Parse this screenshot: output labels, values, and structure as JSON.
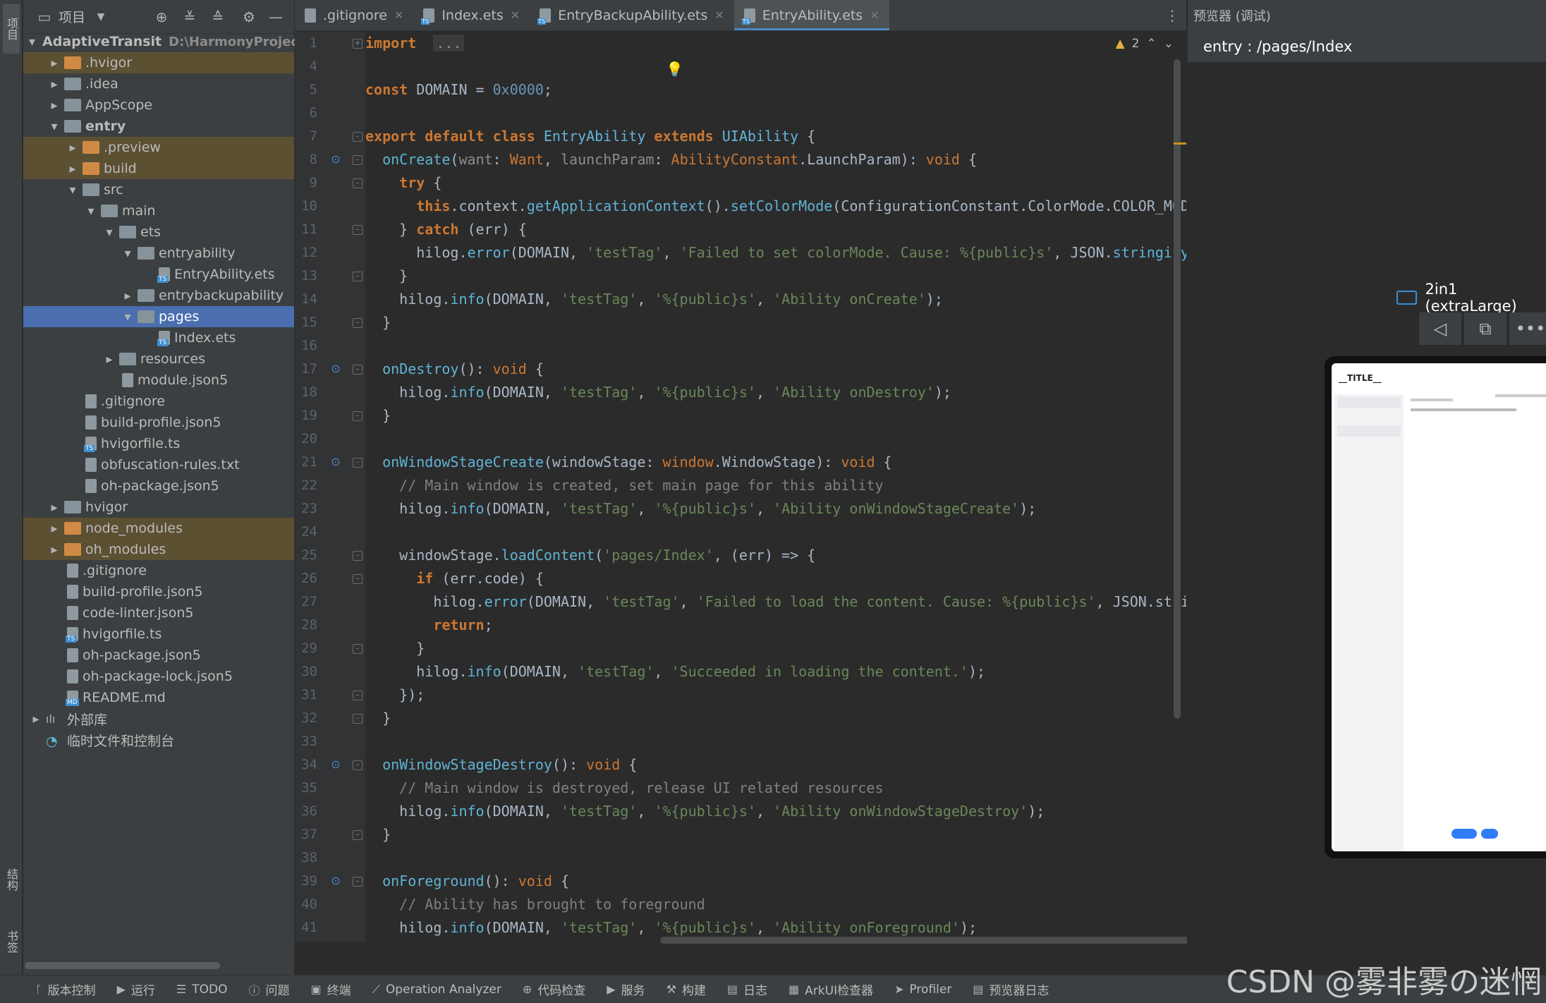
{
  "left_strip": {
    "project": "项目",
    "structure": "结构",
    "bookmarks": "书签"
  },
  "project_panel": {
    "title": "项目",
    "tree": [
      {
        "label": "AdaptiveTransit",
        "path": "D:\\HarmonyProject",
        "depth": 0,
        "arrow": "down",
        "icon": "folder-module",
        "bold": true
      },
      {
        "label": ".hvigor",
        "depth": 1,
        "arrow": "right",
        "icon": "folder-orange",
        "excluded": true
      },
      {
        "label": ".idea",
        "depth": 1,
        "arrow": "right",
        "icon": "folder"
      },
      {
        "label": "AppScope",
        "depth": 1,
        "arrow": "right",
        "icon": "folder"
      },
      {
        "label": "entry",
        "depth": 1,
        "arrow": "down",
        "icon": "folder-module",
        "bold": true
      },
      {
        "label": ".preview",
        "depth": 2,
        "arrow": "right",
        "icon": "folder-orange",
        "excluded": true
      },
      {
        "label": "build",
        "depth": 2,
        "arrow": "right",
        "icon": "folder-orange",
        "excluded": true
      },
      {
        "label": "src",
        "depth": 2,
        "arrow": "down",
        "icon": "folder"
      },
      {
        "label": "main",
        "depth": 3,
        "arrow": "down",
        "icon": "folder"
      },
      {
        "label": "ets",
        "depth": 4,
        "arrow": "down",
        "icon": "folder-blue"
      },
      {
        "label": "entryability",
        "depth": 5,
        "arrow": "down",
        "icon": "folder"
      },
      {
        "label": "EntryAbility.ets",
        "depth": 6,
        "arrow": "",
        "icon": "file-ts"
      },
      {
        "label": "entrybackupability",
        "depth": 5,
        "arrow": "right",
        "icon": "folder"
      },
      {
        "label": "pages",
        "depth": 5,
        "arrow": "down",
        "icon": "folder",
        "selected": true
      },
      {
        "label": "Index.ets",
        "depth": 6,
        "arrow": "",
        "icon": "file-ts"
      },
      {
        "label": "resources",
        "depth": 4,
        "arrow": "right",
        "icon": "folder"
      },
      {
        "label": "module.json5",
        "depth": 4,
        "arrow": "",
        "icon": "file-gen"
      },
      {
        "label": ".gitignore",
        "depth": 2,
        "arrow": "",
        "icon": "file-gen"
      },
      {
        "label": "build-profile.json5",
        "depth": 2,
        "arrow": "",
        "icon": "file-gen"
      },
      {
        "label": "hvigorfile.ts",
        "depth": 2,
        "arrow": "",
        "icon": "file-ts"
      },
      {
        "label": "obfuscation-rules.txt",
        "depth": 2,
        "arrow": "",
        "icon": "file-gen"
      },
      {
        "label": "oh-package.json5",
        "depth": 2,
        "arrow": "",
        "icon": "file-gen"
      },
      {
        "label": "hvigor",
        "depth": 1,
        "arrow": "right",
        "icon": "folder"
      },
      {
        "label": "node_modules",
        "depth": 1,
        "arrow": "right",
        "icon": "folder-orange",
        "excluded": true
      },
      {
        "label": "oh_modules",
        "depth": 1,
        "arrow": "right",
        "icon": "folder-orange",
        "excluded": true
      },
      {
        "label": ".gitignore",
        "depth": 1,
        "arrow": "",
        "icon": "file-gen"
      },
      {
        "label": "build-profile.json5",
        "depth": 1,
        "arrow": "",
        "icon": "file-gen"
      },
      {
        "label": "code-linter.json5",
        "depth": 1,
        "arrow": "",
        "icon": "file-gen"
      },
      {
        "label": "hvigorfile.ts",
        "depth": 1,
        "arrow": "",
        "icon": "file-ts"
      },
      {
        "label": "oh-package.json5",
        "depth": 1,
        "arrow": "",
        "icon": "file-gen"
      },
      {
        "label": "oh-package-lock.json5",
        "depth": 1,
        "arrow": "",
        "icon": "file-gen"
      },
      {
        "label": "README.md",
        "depth": 1,
        "arrow": "",
        "icon": "file-md"
      },
      {
        "label": "外部库",
        "depth": 0,
        "arrow": "right",
        "icon": "library"
      },
      {
        "label": "临时文件和控制台",
        "depth": 0,
        "arrow": "",
        "icon": "scratch"
      }
    ]
  },
  "editor": {
    "tabs": [
      {
        "label": ".gitignore",
        "icon": "file",
        "active": false
      },
      {
        "label": "Index.ets",
        "icon": "ts",
        "active": false
      },
      {
        "label": "EntryBackupAbility.ets",
        "icon": "ts",
        "active": false
      },
      {
        "label": "EntryAbility.ets",
        "icon": "ts",
        "active": true
      }
    ],
    "warnings": "2",
    "lines": [
      {
        "n": "1",
        "fold": "+",
        "code": [
          [
            "kw",
            "import"
          ],
          [
            "",
            "  "
          ],
          [
            "fi",
            "..."
          ]
        ]
      },
      {
        "n": "4",
        "code": []
      },
      {
        "n": "5",
        "code": [
          [
            "kw",
            "const"
          ],
          [
            "",
            " DOMAIN = "
          ],
          [
            "num",
            "0x0000"
          ],
          [
            "",
            ";"
          ]
        ]
      },
      {
        "n": "6",
        "code": []
      },
      {
        "n": "7",
        "fold": "-",
        "code": [
          [
            "kw",
            "export default class"
          ],
          [
            "",
            " "
          ],
          [
            "cls",
            "EntryAbility"
          ],
          [
            "",
            " "
          ],
          [
            "kw",
            "extends"
          ],
          [
            "",
            " "
          ],
          [
            "cls",
            "UIAbility"
          ],
          [
            "",
            " {"
          ]
        ]
      },
      {
        "n": "8",
        "mark": true,
        "fold": "-",
        "code": [
          [
            "",
            "  "
          ],
          [
            "fn",
            "onCreate"
          ],
          [
            "",
            "("
          ],
          [
            "pdim",
            "want"
          ],
          [
            "",
            ": "
          ],
          [
            "ty",
            "Want"
          ],
          [
            "",
            ", "
          ],
          [
            "pdim",
            "launchParam"
          ],
          [
            "",
            ": "
          ],
          [
            "ty",
            "AbilityConstant"
          ],
          [
            "",
            ".LaunchParam): "
          ],
          [
            "kwn",
            "void"
          ],
          [
            "",
            " {"
          ]
        ]
      },
      {
        "n": "9",
        "fold": "-",
        "code": [
          [
            "",
            "    "
          ],
          [
            "kw",
            "try"
          ],
          [
            "",
            " {"
          ]
        ]
      },
      {
        "n": "10",
        "code": [
          [
            "",
            "      "
          ],
          [
            "kw",
            "this"
          ],
          [
            "",
            ".context."
          ],
          [
            "fn",
            "getApplicationContext"
          ],
          [
            "",
            "()."
          ],
          [
            "fn",
            "setColorMode"
          ],
          [
            "",
            "(ConfigurationConstant.ColorMode.COLOR_MOD"
          ]
        ]
      },
      {
        "n": "11",
        "fold": "-",
        "code": [
          [
            "",
            "    } "
          ],
          [
            "kw",
            "catch"
          ],
          [
            "",
            " (err) {"
          ]
        ]
      },
      {
        "n": "12",
        "code": [
          [
            "",
            "      hilog."
          ],
          [
            "fn",
            "error"
          ],
          [
            "",
            "(DOMAIN, "
          ],
          [
            "str",
            "'testTag'"
          ],
          [
            "",
            ", "
          ],
          [
            "str",
            "'Failed to set colorMode. Cause: %{public}s'"
          ],
          [
            "",
            ", JSON."
          ],
          [
            "fn",
            "stringify"
          ]
        ]
      },
      {
        "n": "13",
        "fold": "-",
        "code": [
          [
            "",
            "    }"
          ]
        ]
      },
      {
        "n": "14",
        "code": [
          [
            "",
            "    hilog."
          ],
          [
            "fn",
            "info"
          ],
          [
            "",
            "(DOMAIN, "
          ],
          [
            "str",
            "'testTag'"
          ],
          [
            "",
            ", "
          ],
          [
            "str",
            "'%{public}s'"
          ],
          [
            "",
            ", "
          ],
          [
            "str",
            "'Ability onCreate'"
          ],
          [
            "",
            ");"
          ]
        ]
      },
      {
        "n": "15",
        "fold": "-",
        "code": [
          [
            "",
            "  }"
          ]
        ]
      },
      {
        "n": "16",
        "code": []
      },
      {
        "n": "17",
        "mark": true,
        "fold": "-",
        "code": [
          [
            "",
            "  "
          ],
          [
            "fn",
            "onDestroy"
          ],
          [
            "",
            "(): "
          ],
          [
            "kwn",
            "void"
          ],
          [
            "",
            " {"
          ]
        ]
      },
      {
        "n": "18",
        "code": [
          [
            "",
            "    hilog."
          ],
          [
            "fn",
            "info"
          ],
          [
            "",
            "(DOMAIN, "
          ],
          [
            "str",
            "'testTag'"
          ],
          [
            "",
            ", "
          ],
          [
            "str",
            "'%{public}s'"
          ],
          [
            "",
            ", "
          ],
          [
            "str",
            "'Ability onDestroy'"
          ],
          [
            "",
            ");"
          ]
        ]
      },
      {
        "n": "19",
        "fold": "-",
        "code": [
          [
            "",
            "  }"
          ]
        ]
      },
      {
        "n": "20",
        "code": []
      },
      {
        "n": "21",
        "mark": true,
        "fold": "-",
        "code": [
          [
            "",
            "  "
          ],
          [
            "fn",
            "onWindowStageCreate"
          ],
          [
            "",
            "(windowStage: "
          ],
          [
            "ty",
            "window"
          ],
          [
            "",
            ".WindowStage): "
          ],
          [
            "kwn",
            "void"
          ],
          [
            "",
            " {"
          ]
        ]
      },
      {
        "n": "22",
        "code": [
          [
            "cmt",
            "    // Main window is created, set main page for this ability"
          ]
        ]
      },
      {
        "n": "23",
        "code": [
          [
            "",
            "    hilog."
          ],
          [
            "fn",
            "info"
          ],
          [
            "",
            "(DOMAIN, "
          ],
          [
            "str",
            "'testTag'"
          ],
          [
            "",
            ", "
          ],
          [
            "str",
            "'%{public}s'"
          ],
          [
            "",
            ", "
          ],
          [
            "str",
            "'Ability onWindowStageCreate'"
          ],
          [
            "",
            ");"
          ]
        ]
      },
      {
        "n": "24",
        "code": []
      },
      {
        "n": "25",
        "fold": "-",
        "code": [
          [
            "",
            "    windowStage."
          ],
          [
            "fn",
            "loadContent"
          ],
          [
            "",
            "("
          ],
          [
            "str",
            "'pages/Index'"
          ],
          [
            "",
            ", (err) => {"
          ]
        ]
      },
      {
        "n": "26",
        "fold": "-",
        "code": [
          [
            "",
            "      "
          ],
          [
            "kw",
            "if"
          ],
          [
            "",
            " (err.code) {"
          ]
        ]
      },
      {
        "n": "27",
        "code": [
          [
            "",
            "        hilog."
          ],
          [
            "fn",
            "error"
          ],
          [
            "",
            "(DOMAIN, "
          ],
          [
            "str",
            "'testTag'"
          ],
          [
            "",
            ", "
          ],
          [
            "str",
            "'Failed to load the content. Cause: %{public}s'"
          ],
          [
            "",
            ", JSON.stri"
          ]
        ]
      },
      {
        "n": "28",
        "code": [
          [
            "",
            "        "
          ],
          [
            "kw",
            "return"
          ],
          [
            "",
            ";"
          ]
        ]
      },
      {
        "n": "29",
        "fold": "-",
        "code": [
          [
            "",
            "      }"
          ]
        ]
      },
      {
        "n": "30",
        "code": [
          [
            "",
            "      hilog."
          ],
          [
            "fn",
            "info"
          ],
          [
            "",
            "(DOMAIN, "
          ],
          [
            "str",
            "'testTag'"
          ],
          [
            "",
            ", "
          ],
          [
            "str",
            "'Succeeded in loading the content.'"
          ],
          [
            "",
            ");"
          ]
        ]
      },
      {
        "n": "31",
        "fold": "-",
        "code": [
          [
            "",
            "    });"
          ]
        ]
      },
      {
        "n": "32",
        "fold": "-",
        "code": [
          [
            "",
            "  }"
          ]
        ]
      },
      {
        "n": "33",
        "code": []
      },
      {
        "n": "34",
        "mark": true,
        "fold": "-",
        "code": [
          [
            "",
            "  "
          ],
          [
            "fn",
            "onWindowStageDestroy"
          ],
          [
            "",
            "(): "
          ],
          [
            "kwn",
            "void"
          ],
          [
            "",
            " {"
          ]
        ]
      },
      {
        "n": "35",
        "code": [
          [
            "cmt",
            "    // Main window is destroyed, release UI related resources"
          ]
        ]
      },
      {
        "n": "36",
        "code": [
          [
            "",
            "    hilog."
          ],
          [
            "fn",
            "info"
          ],
          [
            "",
            "(DOMAIN, "
          ],
          [
            "str",
            "'testTag'"
          ],
          [
            "",
            ", "
          ],
          [
            "str",
            "'%{public}s'"
          ],
          [
            "",
            ", "
          ],
          [
            "str",
            "'Ability onWindowStageDestroy'"
          ],
          [
            "",
            ");"
          ]
        ]
      },
      {
        "n": "37",
        "fold": "-",
        "code": [
          [
            "",
            "  }"
          ]
        ]
      },
      {
        "n": "38",
        "code": []
      },
      {
        "n": "39",
        "mark": true,
        "fold": "-",
        "code": [
          [
            "",
            "  "
          ],
          [
            "fn",
            "onForeground"
          ],
          [
            "",
            "(): "
          ],
          [
            "kwn",
            "void"
          ],
          [
            "",
            " {"
          ]
        ]
      },
      {
        "n": "40",
        "code": [
          [
            "cmt",
            "    // Ability has brought to foreground"
          ]
        ]
      },
      {
        "n": "41",
        "code": [
          [
            "",
            "    hilog."
          ],
          [
            "fn",
            "info"
          ],
          [
            "",
            "(DOMAIN, "
          ],
          [
            "str",
            "'testTag'"
          ],
          [
            "",
            ", "
          ],
          [
            "str",
            "'%{public}s'"
          ],
          [
            "",
            ", "
          ],
          [
            "str",
            "'Ability onForeground'"
          ],
          [
            "",
            ");"
          ]
        ]
      }
    ]
  },
  "preview": {
    "title": "预览器 (调试)",
    "route": "entry : /pages/Index",
    "device": "2in1 (extraLarge)",
    "screen_title": "__TITLE__"
  },
  "bottom_bar": [
    {
      "icon": "branch-icon",
      "glyph": "ᚴ",
      "label": "版本控制"
    },
    {
      "icon": "run-icon",
      "glyph": "▶",
      "label": "运行"
    },
    {
      "icon": "todo-icon",
      "glyph": "☰",
      "label": "TODO"
    },
    {
      "icon": "problems-icon",
      "glyph": "ⓘ",
      "label": "问题"
    },
    {
      "icon": "terminal-icon",
      "glyph": "▣",
      "label": "终端"
    },
    {
      "icon": "analyzer-icon",
      "glyph": "⟋",
      "label": "Operation Analyzer"
    },
    {
      "icon": "code-check-icon",
      "glyph": "⊕",
      "label": "代码检查"
    },
    {
      "icon": "services-icon",
      "glyph": "▶",
      "label": "服务"
    },
    {
      "icon": "build-icon",
      "glyph": "⚒",
      "label": "构建"
    },
    {
      "icon": "log-icon",
      "glyph": "▤",
      "label": "日志"
    },
    {
      "icon": "arkui-inspector-icon",
      "glyph": "▦",
      "label": "ArkUI检查器"
    },
    {
      "icon": "profiler-icon",
      "glyph": "➤",
      "label": "Profiler"
    },
    {
      "icon": "preview-log-icon",
      "glyph": "▤",
      "label": "预览器日志"
    }
  ],
  "watermark": "CSDN @雾非雾の迷惘"
}
